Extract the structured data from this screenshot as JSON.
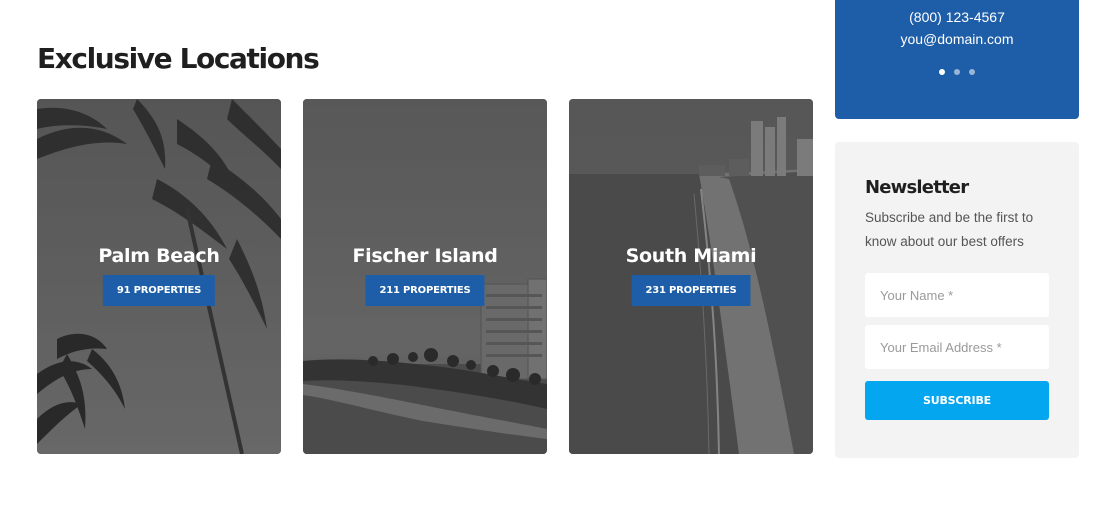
{
  "section": {
    "title": "Exclusive Locations"
  },
  "locations": [
    {
      "name": "Palm Beach",
      "badge": "91 PROPERTIES",
      "count": 91
    },
    {
      "name": "Fischer Island",
      "badge": "211 PROPERTIES",
      "count": 211
    },
    {
      "name": "South Miami",
      "badge": "231 PROPERTIES",
      "count": 231
    }
  ],
  "contact": {
    "phone": "(800) 123-4567",
    "email": "you@domain.com",
    "carousel": {
      "slides": 3,
      "active": 1
    }
  },
  "newsletter": {
    "title": "Newsletter",
    "description": "Subscribe and be the first to know about our best offers",
    "name_placeholder": "Your Name *",
    "email_placeholder": "Your Email Address *",
    "button_label": "SUBSCRIBE"
  },
  "colors": {
    "brand_blue": "#1e5ea8",
    "accent_button": "#05a6f0",
    "panel_bg": "#f3f3f3",
    "heading": "#1f1f1f"
  }
}
